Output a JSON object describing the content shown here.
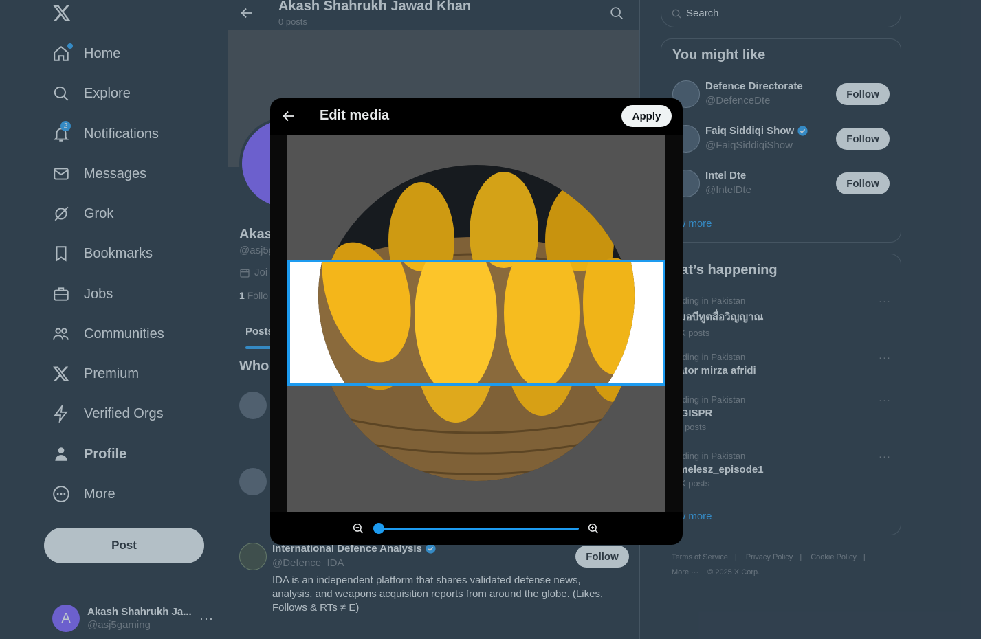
{
  "nav": {
    "items": [
      {
        "label": "Home"
      },
      {
        "label": "Explore"
      },
      {
        "label": "Notifications",
        "badge": "2"
      },
      {
        "label": "Messages"
      },
      {
        "label": "Grok"
      },
      {
        "label": "Bookmarks"
      },
      {
        "label": "Jobs"
      },
      {
        "label": "Communities"
      },
      {
        "label": "Premium"
      },
      {
        "label": "Verified Orgs"
      },
      {
        "label": "Profile"
      },
      {
        "label": "More"
      }
    ],
    "post_label": "Post"
  },
  "account": {
    "initial": "A",
    "name": "Akash Shahrukh Ja...",
    "handle": "@asj5gaming",
    "menu": "···"
  },
  "profile": {
    "title": "Akash Shahrukh Jawad Khan",
    "post_count": "0 posts",
    "name_fragment": "Akas",
    "handle_fragment": "@asj5g",
    "joined_fragment": "Joi",
    "following_count": "1",
    "following_fragment": "Follo",
    "tab_posts": "Posts",
    "who_fragment": "Who"
  },
  "suggestion_ida": {
    "name": "International Defence Analysis",
    "handle": "@Defence_IDA",
    "bio": "IDA is an independent platform that shares validated defense news, analysis, and weapons acquisition reports from around the globe. (Likes, Follows & RTs ≠ E)",
    "follow_label": "Follow"
  },
  "search": {
    "placeholder": "Search"
  },
  "you_might_like": {
    "title": "You might like",
    "accounts": [
      {
        "name": "Defence Directorate",
        "handle": "@DefenceDte",
        "verified": false,
        "follow_label": "Follow"
      },
      {
        "name": "Faiq Siddiqi Show",
        "handle": "@FaiqSiddiqiShow",
        "verified": true,
        "follow_label": "Follow"
      },
      {
        "name": "Intel Dte",
        "handle": "@IntelDte",
        "verified": false,
        "follow_label": "Follow"
      }
    ],
    "show_more": "ow more"
  },
  "whats_happening": {
    "title": "hat’s happening",
    "trends": [
      {
        "context": "ending in Pakistan",
        "topic": "มมอบีทูตสื่อวิญญาณ",
        "count": ".5K posts"
      },
      {
        "context": "ending in Pakistan",
        "topic": "nator mirza afridi",
        "count": ""
      },
      {
        "context": "ending in Pakistan",
        "topic": "OGISPR",
        "count": "29 posts"
      },
      {
        "context": "ending in Pakistan",
        "topic": "timelesz_episode1",
        "count": ".9K posts"
      }
    ],
    "show_more": "ow more"
  },
  "footer": {
    "links": [
      "Terms of Service",
      "|",
      "Privacy Policy",
      "|",
      "Cookie Policy",
      "|"
    ],
    "more": "More ···",
    "copyright": "© 2025 X Corp."
  },
  "modal": {
    "title": "Edit media",
    "apply_label": "Apply",
    "zoom": 0
  },
  "colors": {
    "accent": "#1d9bf0",
    "background": "#15202b",
    "modal_bg": "#000000",
    "avatar": "#7856ff"
  }
}
